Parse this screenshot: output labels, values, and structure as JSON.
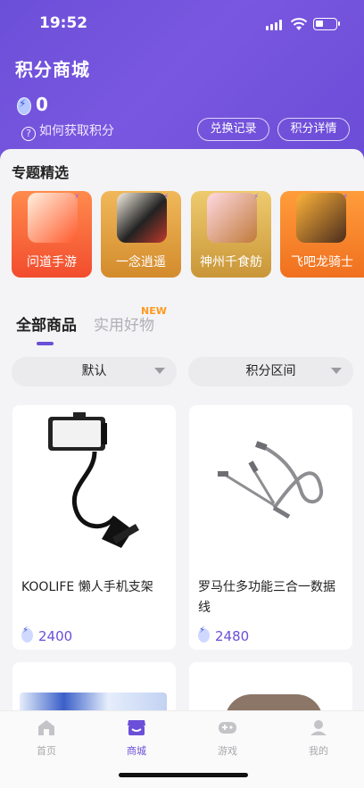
{
  "status_bar": {
    "time": "19:52"
  },
  "header": {
    "title": "积分商城",
    "points_value": "0",
    "how_to_earn": "如何获取积分",
    "exchange_history_button": "兑换记录",
    "points_detail_button": "积分详情"
  },
  "featured": {
    "title": "专题精选",
    "items": [
      {
        "label": "问道手游"
      },
      {
        "label": "一念逍遥"
      },
      {
        "label": "神州千食舫"
      },
      {
        "label": "飞吧龙骑士"
      }
    ]
  },
  "tabs": {
    "all_products": "全部商品",
    "useful_goods": "实用好物",
    "new_badge": "NEW"
  },
  "filters": {
    "sort": "默认",
    "points_range": "积分区间"
  },
  "products": [
    {
      "name": "KOOLIFE 懒人手机支架",
      "price": "2400"
    },
    {
      "name": "罗马仕多功能三合一数据线",
      "price": "2480"
    }
  ],
  "bottom_nav": {
    "home": "首页",
    "mall": "商城",
    "games": "游戏",
    "mine": "我的"
  },
  "colors": {
    "accent": "#6b4fd8",
    "new_badge": "#ff9a1f"
  }
}
